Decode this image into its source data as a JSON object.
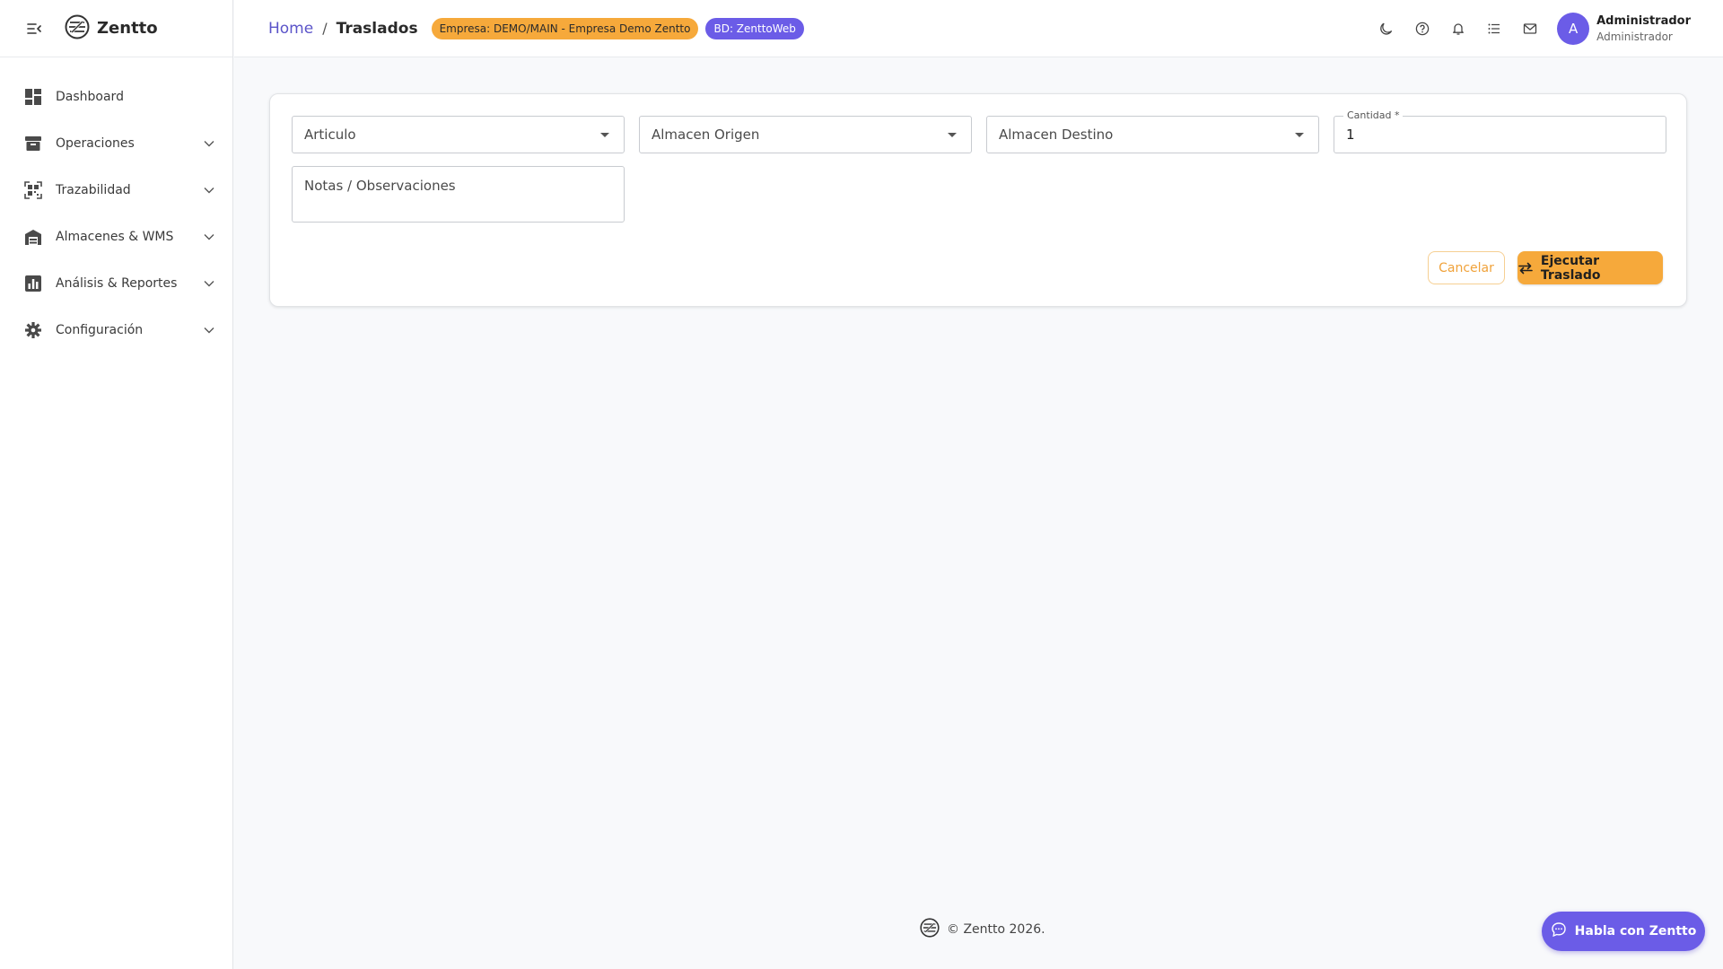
{
  "app": {
    "name": "Zentto"
  },
  "sidebar": {
    "items": [
      {
        "label": "Dashboard",
        "icon": "dashboard-icon",
        "expandable": false
      },
      {
        "label": "Operaciones",
        "icon": "archive-box-icon",
        "expandable": true
      },
      {
        "label": "Trazabilidad",
        "icon": "qr-scan-icon",
        "expandable": true
      },
      {
        "label": "Almacenes & WMS",
        "icon": "warehouse-icon",
        "expandable": true
      },
      {
        "label": "Análisis & Reportes",
        "icon": "bar-chart-icon",
        "expandable": true
      },
      {
        "label": "Configuración",
        "icon": "gear-icon",
        "expandable": true
      }
    ]
  },
  "header": {
    "breadcrumb": {
      "home": "Home",
      "separator": "/",
      "current": "Traslados"
    },
    "badges": {
      "company": "Empresa: DEMO/MAIN - Empresa Demo Zentto",
      "db": "BD: ZenttoWeb"
    },
    "icons": [
      "moon-icon",
      "help-icon",
      "bell-icon",
      "list-icon",
      "mail-icon"
    ],
    "user": {
      "avatar_letter": "A",
      "name": "Administrador",
      "role": "Administrador"
    }
  },
  "form": {
    "articulo": "Articulo",
    "almacen_origen": "Almacen Origen",
    "almacen_destino": "Almacen Destino",
    "cantidad_label": "Cantidad *",
    "cantidad_value": "1",
    "notas_placeholder": "Notas / Observaciones",
    "cancel_label": "Cancelar",
    "execute_label": "Ejecutar Traslado"
  },
  "footer": {
    "text": "© Zentto 2026."
  },
  "chat": {
    "label": "Habla con Zentto"
  },
  "colors": {
    "accent": "#f6a93b",
    "primary": "#6b5ce7",
    "link": "#5b54c9"
  }
}
